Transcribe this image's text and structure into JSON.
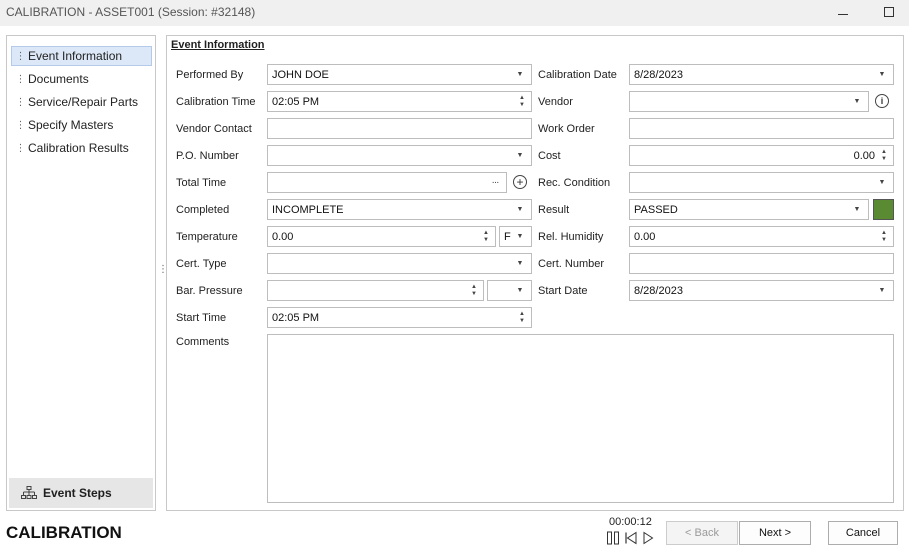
{
  "window": {
    "title": "CALIBRATION - ASSET001 (Session: #32148)"
  },
  "sidebar": {
    "items": [
      {
        "label": "Event Information",
        "active": true
      },
      {
        "label": "Documents",
        "active": false
      },
      {
        "label": "Service/Repair Parts",
        "active": false
      },
      {
        "label": "Specify Masters",
        "active": false
      },
      {
        "label": "Calibration Results",
        "active": false
      }
    ],
    "footer_label": "Event Steps"
  },
  "form": {
    "section_title": "Event Information",
    "performed_by": {
      "label": "Performed By",
      "value": "JOHN DOE"
    },
    "calibration_date": {
      "label": "Calibration Date",
      "value": "8/28/2023"
    },
    "calibration_time": {
      "label": "Calibration Time",
      "value": "02:05 PM"
    },
    "vendor": {
      "label": "Vendor",
      "value": ""
    },
    "vendor_contact": {
      "label": "Vendor Contact",
      "value": ""
    },
    "work_order": {
      "label": "Work Order",
      "value": ""
    },
    "po_number": {
      "label": "P.O. Number",
      "value": ""
    },
    "cost": {
      "label": "Cost",
      "value": "0.00"
    },
    "total_time": {
      "label": "Total Time",
      "value": ""
    },
    "rec_condition": {
      "label": "Rec. Condition",
      "value": ""
    },
    "completed": {
      "label": "Completed",
      "value": "INCOMPLETE"
    },
    "result": {
      "label": "Result",
      "value": "PASSED",
      "color": "#5a8a32"
    },
    "temperature": {
      "label": "Temperature",
      "value": "0.00",
      "unit": "F"
    },
    "rel_humidity": {
      "label": "Rel. Humidity",
      "value": "0.00"
    },
    "cert_type": {
      "label": "Cert. Type",
      "value": ""
    },
    "cert_number": {
      "label": "Cert. Number",
      "value": ""
    },
    "bar_pressure": {
      "label": "Bar. Pressure",
      "value": "",
      "unit": ""
    },
    "start_date": {
      "label": "Start Date",
      "value": "8/28/2023"
    },
    "start_time": {
      "label": "Start Time",
      "value": "02:05 PM"
    },
    "comments": {
      "label": "Comments",
      "value": ""
    }
  },
  "footer": {
    "title": "CALIBRATION",
    "timer": "00:00:12",
    "back_label": "< Back",
    "next_label": "Next >",
    "cancel_label": "Cancel"
  },
  "icons": {
    "sidebar_grip": "grip-dots-icon",
    "event_steps": "org-chart-icon",
    "vendor_info": "info-icon",
    "total_time_add": "plus-circle-icon"
  }
}
